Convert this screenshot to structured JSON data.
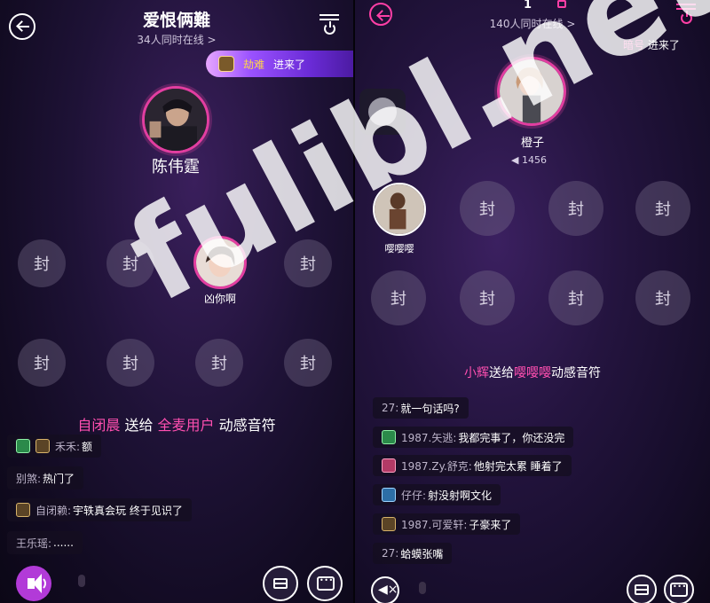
{
  "watermark": "fulibl.net",
  "left": {
    "title": "爱恨俩難",
    "online": "34人同时在线 >",
    "join_banner": {
      "name": "劫难",
      "text": "进来了"
    },
    "host": {
      "name": "陈伟霆"
    },
    "seat_label": "封",
    "occupied_seat": {
      "name": "凶你啊"
    },
    "gift": {
      "from": "自闭晨",
      "verb": "送给",
      "to": "全麦用户",
      "item": "动感音符"
    },
    "chat": [
      {
        "name": "禾禾:",
        "text": "额"
      },
      {
        "name": "别煞:",
        "text": "热门了"
      },
      {
        "name": "自闭赖:",
        "text": "宇轶真会玩 终于见识了"
      },
      {
        "name": "王乐瑶:",
        "text": "......"
      }
    ]
  },
  "right": {
    "seat_count": "1",
    "online": "140人同时在线 >",
    "join_text": {
      "name": "暗号",
      "text": "进来了"
    },
    "host": {
      "name": "橙子",
      "heat": "1456"
    },
    "side_user": {
      "name": "嘤嘤嘤"
    },
    "seat_label": "封",
    "gift": {
      "from": "小辉",
      "verb": "送给",
      "to": "嘤嘤嘤",
      "item": "动感音符"
    },
    "chat": [
      {
        "name": "27:",
        "text": "就一句话吗?"
      },
      {
        "name": "1987.矢逃:",
        "text": "我都完事了，你还没完"
      },
      {
        "name": "1987.Zy.舒克:",
        "text": "他射完太累 睡着了"
      },
      {
        "name": "仔仔:",
        "text": "射没射啊文化"
      },
      {
        "name": "1987.可爱轩:",
        "text": "子豪来了"
      },
      {
        "name": "27:",
        "text": "蛤蟆张嘴"
      }
    ]
  }
}
